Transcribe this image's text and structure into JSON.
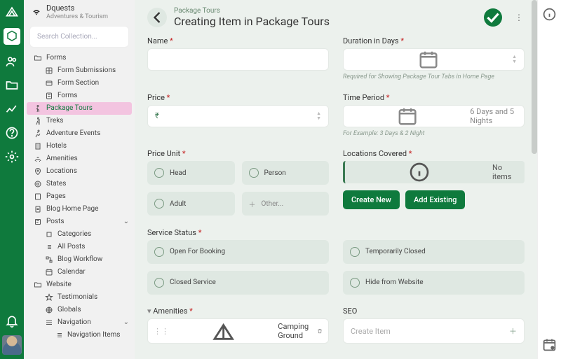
{
  "brand": {
    "name": "Dquests",
    "subtitle": "Adventures & Tourism"
  },
  "search": {
    "placeholder": "Search Collection..."
  },
  "sidebar": {
    "items": [
      {
        "label": "Forms",
        "depth": 0,
        "icon": "folder-open"
      },
      {
        "label": "Form Submissions",
        "depth": 1,
        "icon": "inbox"
      },
      {
        "label": "Form Section",
        "depth": 1,
        "icon": "section"
      },
      {
        "label": "Forms",
        "depth": 1,
        "icon": "form"
      },
      {
        "label": "Package Tours",
        "depth": 0,
        "icon": "walk",
        "active": true
      },
      {
        "label": "Treks",
        "depth": 0,
        "icon": "hiker"
      },
      {
        "label": "Adventure Events",
        "depth": 0,
        "icon": "run"
      },
      {
        "label": "Hotels",
        "depth": 0,
        "icon": "building"
      },
      {
        "label": "Amenities",
        "depth": 0,
        "icon": "amenity"
      },
      {
        "label": "Locations",
        "depth": 0,
        "icon": "pin"
      },
      {
        "label": "States",
        "depth": 0,
        "icon": "target"
      },
      {
        "label": "Pages",
        "depth": 0,
        "icon": "pages"
      },
      {
        "label": "Blog Home Page",
        "depth": 0,
        "icon": "doc"
      },
      {
        "label": "Posts",
        "depth": 0,
        "icon": "posts",
        "chev": true
      },
      {
        "label": "Categories",
        "depth": 1,
        "icon": "tag"
      },
      {
        "label": "All Posts",
        "depth": 1,
        "icon": "list"
      },
      {
        "label": "Blog Workflow",
        "depth": 1,
        "icon": "flow"
      },
      {
        "label": "Calendar",
        "depth": 1,
        "icon": "cal"
      },
      {
        "label": "Website",
        "depth": 0,
        "icon": "folder"
      },
      {
        "label": "Testimonials",
        "depth": 1,
        "icon": "star"
      },
      {
        "label": "Globals",
        "depth": 1,
        "icon": "globe"
      },
      {
        "label": "Navigation",
        "depth": 1,
        "icon": "nav",
        "chev": true
      },
      {
        "label": "Navigation Items",
        "depth": 2,
        "icon": "navitem"
      }
    ]
  },
  "header": {
    "crumb": "Package Tours",
    "title": "Creating Item in Package Tours"
  },
  "fields": {
    "name": {
      "label": "Name"
    },
    "duration": {
      "label": "Duration in Days",
      "hint": "Required for Showing Package Tour Tabs in Home Page"
    },
    "price": {
      "label": "Price",
      "currency": "₹"
    },
    "timeperiod": {
      "label": "Time Period",
      "placeholder": "6 Days and 5 Nights",
      "hint": "For Example: 3 Days & 2 Night"
    },
    "priceunit": {
      "label": "Price Unit",
      "options": [
        "Head",
        "Person",
        "Adult",
        "Other..."
      ]
    },
    "locations": {
      "label": "Locations Covered",
      "noitems": "No items",
      "create": "Create New",
      "add": "Add Existing"
    },
    "servicestatus": {
      "label": "Service Status",
      "options": [
        "Open For Booking",
        "Temporarily Closed",
        "Closed Service",
        "Hide from Website"
      ]
    },
    "amenities": {
      "label": "Amenities",
      "selected": "Camping Ground"
    },
    "seo": {
      "label": "SEO",
      "placeholder": "Create Item"
    }
  }
}
